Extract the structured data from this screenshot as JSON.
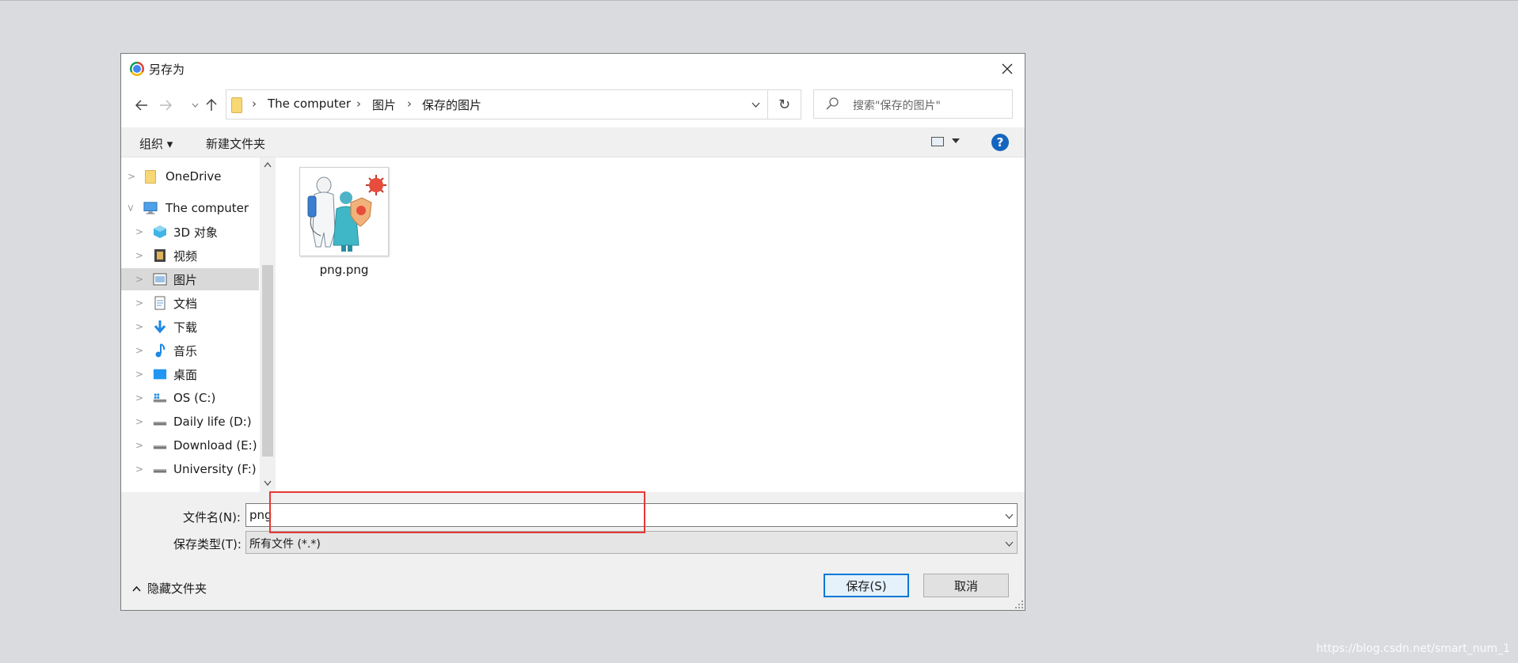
{
  "window": {
    "title": "另存为"
  },
  "address": {
    "crumbs": [
      "The computer",
      "图片",
      "保存的图片"
    ],
    "search_placeholder": "搜索\"保存的图片\""
  },
  "toolbar": {
    "organize": "组织 ▾",
    "new_folder": "新建文件夹",
    "help": "?"
  },
  "nav": {
    "items": [
      {
        "label": "OneDrive",
        "icon": "folder-icon"
      },
      {
        "label": "The computer",
        "icon": "computer-icon"
      },
      {
        "label": "3D 对象",
        "icon": "cube-icon"
      },
      {
        "label": "视频",
        "icon": "film-icon"
      },
      {
        "label": "图片",
        "icon": "picture-icon",
        "selected": true
      },
      {
        "label": "文档",
        "icon": "document-icon"
      },
      {
        "label": "下载",
        "icon": "download-arrow-icon"
      },
      {
        "label": "音乐",
        "icon": "music-note-icon"
      },
      {
        "label": "桌面",
        "icon": "desktop-icon"
      },
      {
        "label": "OS (C:)",
        "icon": "windows-drive-icon"
      },
      {
        "label": "Daily life (D:)",
        "icon": "drive-icon"
      },
      {
        "label": "Download (E:)",
        "icon": "drive-icon"
      },
      {
        "label": "University (F:)",
        "icon": "drive-icon"
      }
    ]
  },
  "files": [
    {
      "name": "png.png",
      "icon": "image-thumbnail"
    }
  ],
  "form": {
    "filename_label": "文件名(N):",
    "filename_value": "png",
    "filetype_label": "保存类型(T):",
    "filetype_value": "所有文件 (*.*)"
  },
  "footer": {
    "hide_folders": "隐藏文件夹",
    "save": "保存(S)",
    "cancel": "取消"
  },
  "watermark": "https://blog.csdn.net/smart_num_1",
  "colors": {
    "accent": "#0078d7",
    "highlight": "#e53935",
    "help": "#1565c0"
  }
}
